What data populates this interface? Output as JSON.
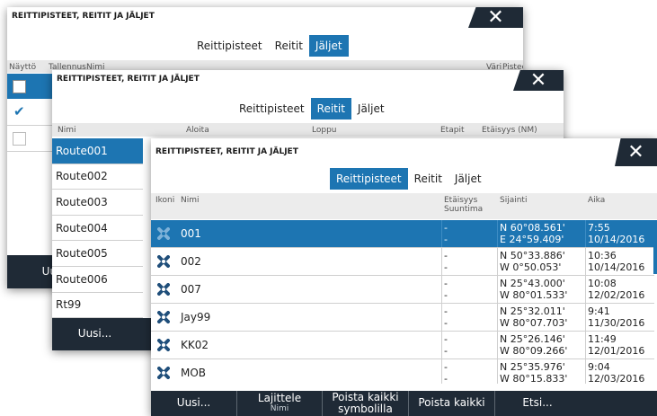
{
  "dialog_title": "REITTIPISTEET, REITIT JA JÄLJET",
  "tabs": {
    "waypoints": "Reittipisteet",
    "routes": "Reitit",
    "trails": "Jäljet"
  },
  "back_dialog": {
    "headers": {
      "show": "Näyttö",
      "record": "Tallennus",
      "name": "Nimi",
      "color": "Väri",
      "points": "Pisteet"
    },
    "footer_label": "Uus"
  },
  "mid_dialog": {
    "headers": {
      "name": "Nimi",
      "start": "Aloita",
      "end": "Loppu",
      "legs": "Etapit",
      "distance": "Etäisyys (NM)"
    },
    "routes": [
      "Route001",
      "Route002",
      "Route003",
      "Route004",
      "Route005",
      "Route006",
      "Rt99"
    ],
    "footer_new": "Uusi..."
  },
  "front_dialog": {
    "headers": {
      "icon": "Ikoni",
      "name": "Nimi",
      "distance": "Etäisyys",
      "bearing": "Suuntima",
      "position": "Sijainti",
      "time": "Aika"
    },
    "waypoints": [
      {
        "name": "001",
        "dist": "-",
        "bearing": "-",
        "lat": "N  60°08.561'",
        "lon": "E  24°59.409'",
        "time": "7:55",
        "date": "10/14/2016"
      },
      {
        "name": "002",
        "dist": "-",
        "bearing": "-",
        "lat": "N  50°33.886'",
        "lon": "W   0°50.053'",
        "time": "10:36",
        "date": "10/14/2016"
      },
      {
        "name": "007",
        "dist": "-",
        "bearing": "-",
        "lat": "N  25°43.000'",
        "lon": "W  80°01.533'",
        "time": "10:08",
        "date": "12/02/2016"
      },
      {
        "name": "Jay99",
        "dist": "-",
        "bearing": "-",
        "lat": "N  25°32.011'",
        "lon": "W  80°07.703'",
        "time": "9:41",
        "date": "11/30/2016"
      },
      {
        "name": "KK02",
        "dist": "-",
        "bearing": "-",
        "lat": "N  25°26.146'",
        "lon": "W  80°09.266'",
        "time": "11:49",
        "date": "12/01/2016"
      },
      {
        "name": "MOB",
        "dist": "-",
        "bearing": "-",
        "lat": "N  25°35.976'",
        "lon": "W  80°15.833'",
        "time": "9:04",
        "date": "12/03/2016"
      }
    ],
    "footer": {
      "new": "Uusi...",
      "sort": "Lajittele",
      "sort_sub": "Nimi",
      "delete_all_symbol_1": "Poista kaikki",
      "delete_all_symbol_2": "symbolilla",
      "delete_all": "Poista kaikki",
      "find": "Etsi..."
    }
  },
  "colors": {
    "accent": "#1d75b2",
    "dark": "#1f2a36"
  }
}
